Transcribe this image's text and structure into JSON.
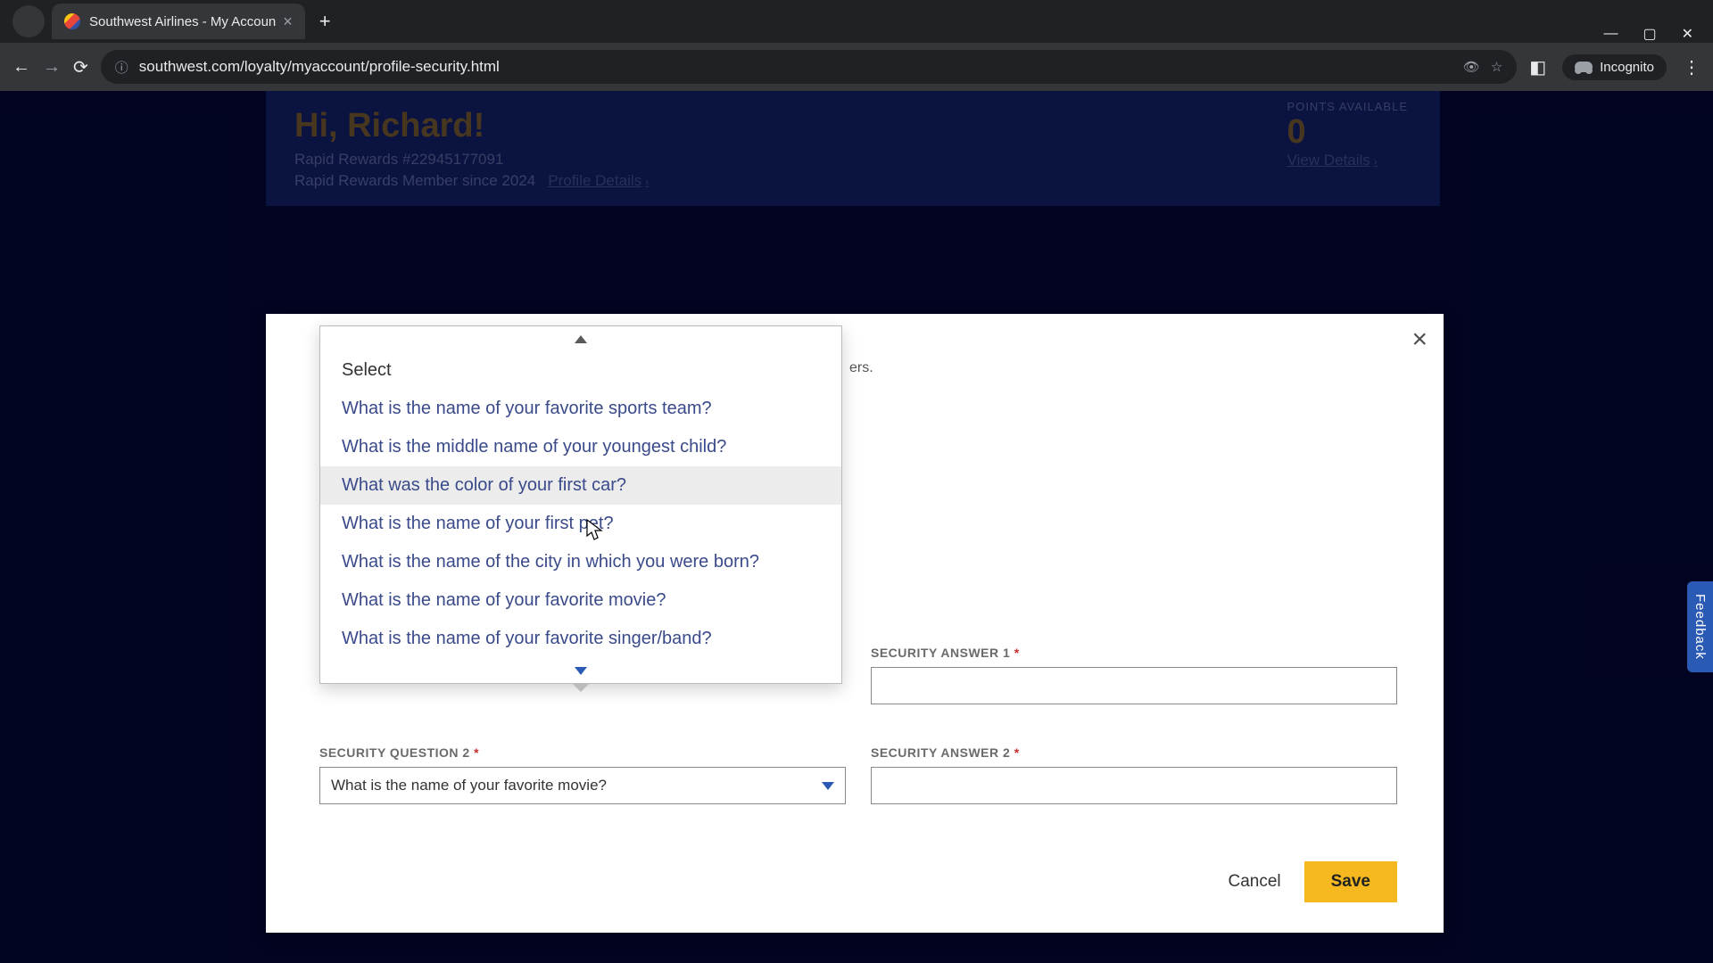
{
  "browser": {
    "tab_title": "Southwest Airlines - My Accoun",
    "url": "southwest.com/loyalty/myaccount/profile-security.html",
    "incognito_label": "Incognito"
  },
  "page": {
    "greeting": "Hi, Richard!",
    "rr_number_label": "Rapid Rewards #22945177091",
    "member_since": "Rapid Rewards Member since 2024",
    "profile_details": "Profile Details",
    "points_label": "POINTS AVAILABLE",
    "points_value": "0",
    "view_details": "View Details",
    "hint_fragment": "ers."
  },
  "modal": {
    "q2_label": "SECURITY QUESTION 2",
    "a1_label": "SECURITY ANSWER 1",
    "a2_label": "SECURITY ANSWER 2",
    "required_mark": "*",
    "q2_selected": "What is the name of your favorite movie?",
    "cancel": "Cancel",
    "save": "Save",
    "close": "×"
  },
  "dropdown": {
    "placeholder": "Select",
    "opt0": "What is the name of your favorite sports team?",
    "opt1": "What is the middle name of your youngest child?",
    "opt2": "What was the color of your first car?",
    "opt3": "What is the name of your first pet?",
    "opt4": "What is the name of the city in which you were born?",
    "opt5": "What is the name of your favorite movie?",
    "opt6": "What is the name of your favorite singer/band?"
  },
  "feedback": "Feedback"
}
